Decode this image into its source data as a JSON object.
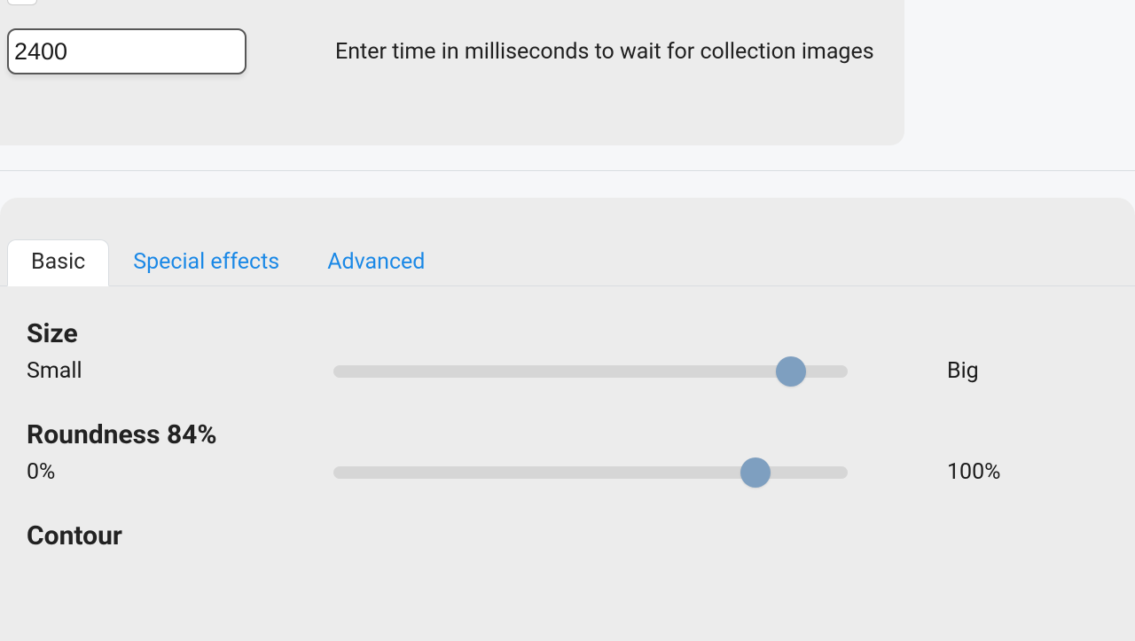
{
  "top": {
    "input_value": "2400",
    "help": "Enter time in milliseconds to wait for collection images"
  },
  "tabs": [
    {
      "label": "Basic",
      "active": true
    },
    {
      "label": "Special effects",
      "active": false
    },
    {
      "label": "Advanced",
      "active": false
    }
  ],
  "size": {
    "title": "Size",
    "min_label": "Small",
    "max_label": "Big",
    "percent": 89
  },
  "roundness": {
    "title": "Roundness 84%",
    "min_label": "0%",
    "max_label": "100%",
    "percent": 82
  },
  "contour": {
    "title": "Contour"
  }
}
